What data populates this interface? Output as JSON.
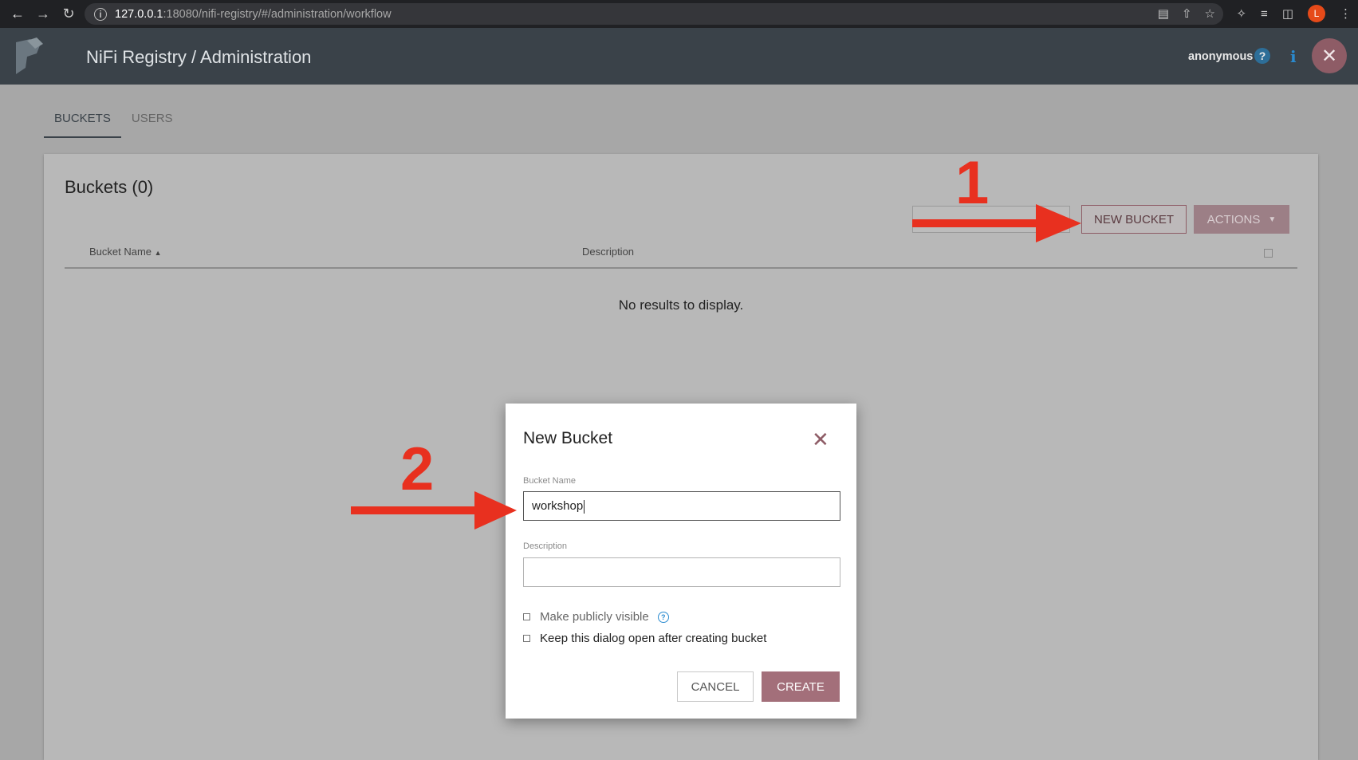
{
  "browser": {
    "url_host": "127.0.0.1",
    "url_path": ":18080/nifi-registry/#/administration/workflow",
    "profile_initial": "L"
  },
  "header": {
    "title": "NiFi Registry / Administration",
    "user": "anonymous"
  },
  "tabs": [
    {
      "label": "BUCKETS",
      "active": true
    },
    {
      "label": "USERS",
      "active": false
    }
  ],
  "buckets": {
    "title": "Buckets (0)",
    "new_bucket_label": "NEW BUCKET",
    "actions_label": "ACTIONS",
    "columns": {
      "name": "Bucket Name",
      "description": "Description"
    },
    "empty_message": "No results to display."
  },
  "annotations": {
    "step1": "1",
    "step2": "2"
  },
  "dialog": {
    "title": "New Bucket",
    "name_label": "Bucket Name",
    "name_value": "workshop",
    "description_label": "Description",
    "description_value": "",
    "public_label": "Make publicly visible",
    "keep_open_label": "Keep this dialog open after creating bucket",
    "cancel_label": "CANCEL",
    "create_label": "CREATE"
  },
  "colors": {
    "header_bg": "#3a4249",
    "accent": "#8e5c66",
    "annotation_red": "#e8301f"
  },
  "icons": [
    "back-arrow-icon",
    "forward-arrow-icon",
    "reload-icon",
    "info-icon",
    "translate-icon",
    "share-icon",
    "star-icon",
    "extensions-icon",
    "reading-list-icon",
    "sidebar-icon",
    "menu-dots-icon",
    "nifi-logo",
    "help-icon",
    "about-icon",
    "close-icon",
    "sort-up-icon",
    "caret-down-icon"
  ]
}
